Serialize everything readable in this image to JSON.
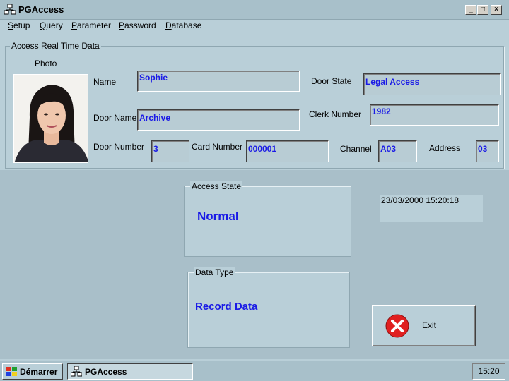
{
  "window": {
    "title": "PGAccess",
    "icon": "network-computers-icon"
  },
  "menu": [
    {
      "label": "Setup",
      "mnemonic": "S",
      "rest": "etup"
    },
    {
      "label": "Query",
      "mnemonic": "Q",
      "rest": "uery"
    },
    {
      "label": "Parameter",
      "mnemonic": "P",
      "rest": "arameter"
    },
    {
      "label": "Password",
      "mnemonic": "P",
      "rest": "assword"
    },
    {
      "label": "Database",
      "mnemonic": "D",
      "rest": "atabase"
    }
  ],
  "access_group": {
    "title": "Access Real Time Data",
    "photo_label": "Photo",
    "name_label": "Name",
    "name_value": "Sophie",
    "door_state_label": "Door State",
    "door_state_value": "Legal Access",
    "door_name_label": "Door Name",
    "door_name_value": "Archive",
    "clerk_number_label": "Clerk Number",
    "clerk_number_value": "1982",
    "door_number_label": "Door Number",
    "door_number_value": "3",
    "card_number_label": "Card Number",
    "card_number_value": "000001",
    "channel_label": "Channel",
    "channel_value": "A03",
    "address_label": "Address",
    "address_value": "03"
  },
  "access_state": {
    "title": "Access State",
    "value": "Normal"
  },
  "data_type": {
    "title": "Data Type",
    "value": "Record Data"
  },
  "datetime": "23/03/2000 15:20:18",
  "exit_button": {
    "mnemonic": "E",
    "rest": "xit"
  },
  "taskbar": {
    "start_label": "Démarrer",
    "task_label": "PGAccess",
    "clock": "15:20"
  },
  "colors": {
    "background": "#b9cfd8",
    "value_text": "#1a1ae6",
    "exit_icon": "#e02020"
  }
}
